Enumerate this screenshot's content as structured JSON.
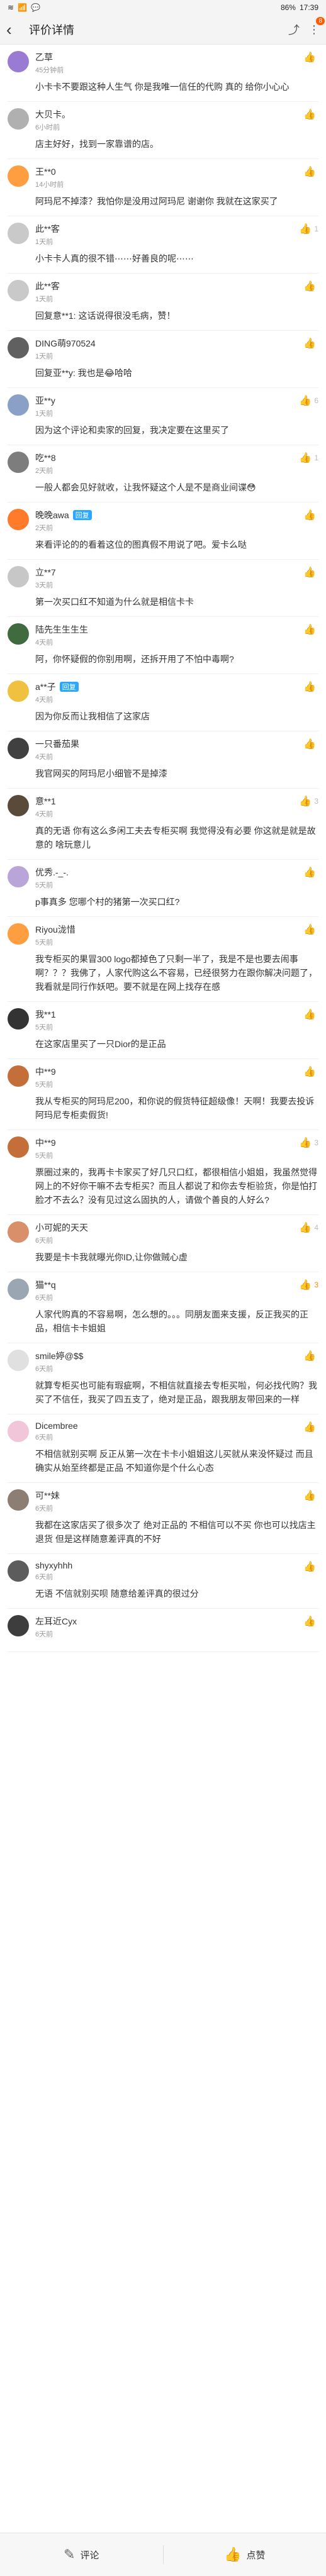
{
  "status": {
    "left_icons": [
      "≋",
      "📶",
      "💬"
    ],
    "battery": "86%",
    "time": "17:39"
  },
  "topbar": {
    "title": "评价详情",
    "badge": "8"
  },
  "reviews": [
    {
      "name": "乙草",
      "time": "45分钟前",
      "text": "小卡卡不要跟这种人生气 你是我唯一信任的代购 真的 给你小心心",
      "likes": "",
      "active": false,
      "avatar": "#9a7bd3"
    },
    {
      "name": "大贝卡。",
      "time": "6小时前",
      "text": "店主好好，找到一家靠谱的店。",
      "likes": "",
      "active": false,
      "avatar": "#b0b0b0"
    },
    {
      "name": "王**0",
      "time": "14小时前",
      "text": "阿玛尼不掉漆？我怕你是没用过阿玛尼 谢谢你 我就在这家买了",
      "likes": "",
      "active": false,
      "avatar": "#ff9e40"
    },
    {
      "name": "此**客",
      "time": "1天前",
      "text": "小卡卡人真的很不错⋯⋯好善良的呢⋯⋯",
      "likes": "1",
      "active": false,
      "avatar": "#c9c9c9"
    },
    {
      "name": "此**客",
      "time": "1天前",
      "text": "回复意**1: 这话说得很没毛病，赞！",
      "likes": "",
      "active": false,
      "avatar": "#c9c9c9"
    },
    {
      "name": "DING萌970524",
      "time": "1天前",
      "text": "回复亚**y: 我也是😂哈哈",
      "likes": "",
      "active": false,
      "avatar": "#606060"
    },
    {
      "name": "亚**y",
      "time": "1天前",
      "text": "因为这个评论和卖家的回复，我决定要在这里买了",
      "likes": "6",
      "active": false,
      "avatar": "#8aa0c7"
    },
    {
      "name": "吃**8",
      "time": "2天前",
      "text": "一般人都会见好就收，让我怀疑这个人是不是商业间谍😳",
      "likes": "1",
      "active": false,
      "avatar": "#7d7d7d"
    },
    {
      "name": "晚晚awa",
      "tag": "回复",
      "time": "2天前",
      "text": "来看评论的的看着这位的图真假不用说了吧。爱卡么哒",
      "likes": "",
      "active": false,
      "avatar": "#ff7a2b"
    },
    {
      "name": "立**7",
      "time": "3天前",
      "text": "第一次买口红不知道为什么就是相信卡卡",
      "likes": "",
      "active": false,
      "avatar": "#c7c7c7"
    },
    {
      "name": "陆先生生生生",
      "time": "4天前",
      "text": "阿，你怀疑假的你别用啊，还拆开用了不怕中毒啊?",
      "likes": "",
      "active": false,
      "avatar": "#3f6b3f"
    },
    {
      "name": "a**子",
      "tag": "回复",
      "time": "4天前",
      "text": "因为你反而让我相信了这家店",
      "likes": "",
      "active": false,
      "avatar": "#f0c040"
    },
    {
      "name": "一只番茄果",
      "time": "4天前",
      "text": "我官网买的阿玛尼小细管不是掉漆",
      "likes": "",
      "active": false,
      "avatar": "#404040"
    },
    {
      "name": "意**1",
      "time": "4天前",
      "text": "真的无语 你有这么多闲工夫去专柜买啊 我觉得没有必要 你这就是就是故意的 啥玩意儿",
      "likes": "3",
      "active": false,
      "avatar": "#5a4a3a"
    },
    {
      "name": "优秀.-_-.",
      "time": "5天前",
      "text": "p事真多 您哪个村的猪第一次买口红?",
      "likes": "",
      "active": false,
      "avatar": "#b9a5d8"
    },
    {
      "name": "Riyou泷惜",
      "time": "5天前",
      "text": "我专柜买的果冒300 logo都掉色了只剩一半了，我是不是也要去闹事啊？？？我佛了，人家代购这么不容易，已经很努力在跟你解决问题了，我看就是同行作妖吧。要不就是在网上找存在感",
      "likes": "",
      "active": false,
      "avatar": "#ff9e40"
    },
    {
      "name": "我**1",
      "time": "5天前",
      "text": "在这家店里买了一只Dior的是正品",
      "likes": "",
      "active": false,
      "avatar": "#333333"
    },
    {
      "name": "中**9",
      "time": "5天前",
      "text": "我从专柜买的阿玛尼200，和你说的假货特征超级像！天啊！我要去投诉阿玛尼专柜卖假货!",
      "likes": "",
      "active": false,
      "avatar": "#c46f3a"
    },
    {
      "name": "中**9",
      "time": "5天前",
      "text": "票圈过来的，我再卡卡家买了好几只口红，都很相信小姐姐，我虽然觉得网上的不好你干嘛不去专柜买？而且人都说了和你去专柜验货，你是怕打脸才不去么？没有见过这么固执的人，请做个善良的人好么?",
      "likes": "3",
      "active": false,
      "avatar": "#c46f3a"
    },
    {
      "name": "小可妮的天天",
      "time": "6天前",
      "text": "我要是卡卡我就曝光你ID,让你做贼心虚",
      "likes": "4",
      "active": false,
      "avatar": "#d98f6a"
    },
    {
      "name": "猫**q",
      "time": "6天前",
      "text": "人家代购真的不容易啊，怎么想的。。。同朋友面来支援，反正我买的正品，相信卡卡姐姐",
      "likes": "3",
      "active": true,
      "avatar": "#9aa6b2"
    },
    {
      "name": "smile婷@$$",
      "time": "6天前",
      "text": "就算专柜买也可能有瑕疵啊，不相信就直接去专柜买啦，何必找代购？我买了不信任，我买了四五支了，绝对是正品，跟我朋友带回来的一样",
      "likes": "",
      "active": false,
      "avatar": "#e0e0e0"
    },
    {
      "name": "Dicembree",
      "time": "6天前",
      "text": "不相信就别买啊 反正从第一次在卡卡小姐姐这儿买就从来没怀疑过 而且确实从始至终都是正品 不知道你是个什么心态",
      "likes": "",
      "active": false,
      "avatar": "#f2c6d9"
    },
    {
      "name": "可**妹",
      "time": "6天前",
      "text": "我都在这家店买了很多次了 绝对正品的 不相信可以不买 你也可以找店主退货 但是这样随意差评真的不好",
      "likes": "",
      "active": false,
      "avatar": "#8c7e72"
    },
    {
      "name": "shyxyhhh",
      "time": "6天前",
      "text": "无语 不信就别买呗 随意给差评真的很过分",
      "likes": "",
      "active": false,
      "avatar": "#5c5c5c"
    },
    {
      "name": "左耳近Cyx",
      "time": "6天前",
      "text": "",
      "likes": "",
      "active": false,
      "avatar": "#3d3d3d"
    }
  ],
  "bottom": {
    "comment_label": "评论",
    "like_label": "点赞"
  }
}
